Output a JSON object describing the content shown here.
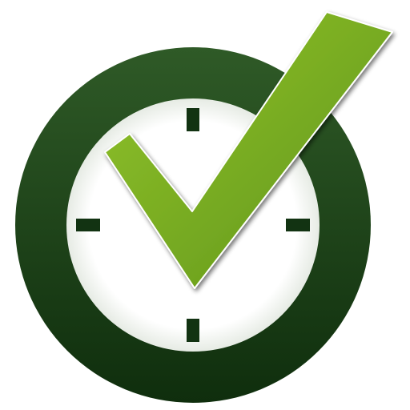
{
  "icon": {
    "name": "clock-checkmark-icon",
    "parts": [
      "clock-icon",
      "checkmark-icon"
    ]
  },
  "colors": {
    "background": "#ffffff",
    "ring_dark": "#0f2e0d",
    "ring_light": "#2f5a27",
    "face": "#ffffff",
    "tick": "#123312",
    "check_light": "#93c42c",
    "check_dark": "#5e9418"
  }
}
